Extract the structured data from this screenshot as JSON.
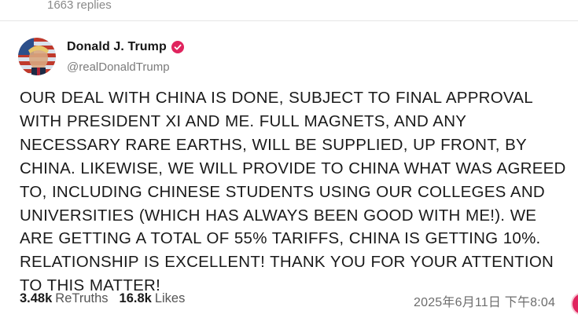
{
  "thread": {
    "replies_label": "1663 replies"
  },
  "post": {
    "author": {
      "name": "Donald J. Trump",
      "handle": "@realDonaldTrump",
      "verified_color": "#e0245e"
    },
    "text": "OUR DEAL WITH CHINA IS DONE, SUBJECT TO FINAL APPROVAL WITH PRESIDENT XI AND ME. FULL MAGNETS, AND ANY NECESSARY RARE EARTHS, WILL BE SUPPLIED, UP FRONT, BY CHINA. LIKEWISE, WE WILL PROVIDE TO CHINA WHAT WAS AGREED TO, INCLUDING CHINESE STUDENTS USING OUR COLLEGES AND UNIVERSITIES (WHICH HAS ALWAYS BEEN GOOD WITH ME!). WE ARE GETTING A TOTAL OF 55% TARIFFS, CHINA IS GETTING 10%. RELATIONSHIP IS EXCELLENT! THANK YOU FOR YOUR ATTENTION TO THIS MATTER!",
    "retruths_count": "3.48k",
    "retruths_label": "ReTruths",
    "likes_count": "16.8k",
    "likes_label": "Likes",
    "timestamp": "2025年6月11日 下午8:04"
  }
}
